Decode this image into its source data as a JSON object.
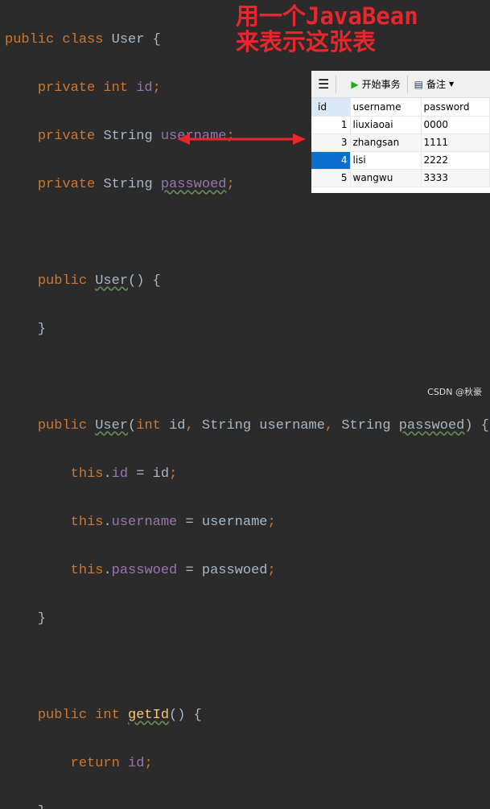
{
  "code": {
    "lines": [
      "public class User {",
      "private int id;",
      "private String username;",
      "private String passwoed;",
      "",
      "public User() {",
      "}",
      "",
      "public User(int id, String username, String passwoed) {",
      "this.id = id;",
      "this.username = username;",
      "this.passwoed = passwoed;",
      "}",
      "",
      "public int getId() {",
      "return id;",
      "}"
    ]
  },
  "annotation": {
    "line1": "用一个JavaBean",
    "line2": "来表示这张表",
    "color": "#e8262b"
  },
  "panel": {
    "toolbar": {
      "menu_icon": "hamburger-icon",
      "begin_transaction": "开始事务",
      "note": "备注"
    },
    "columns": [
      "id",
      "username",
      "password"
    ],
    "rows": [
      {
        "id": "1",
        "username": "liuxiaoai",
        "password": "0000"
      },
      {
        "id": "3",
        "username": "zhangsan",
        "password": "1111"
      },
      {
        "id": "4",
        "username": "lisi",
        "password": "2222"
      },
      {
        "id": "5",
        "username": "wangwu",
        "password": "3333"
      }
    ],
    "selected_row": 2
  },
  "watermark": "CSDN @秋豪"
}
